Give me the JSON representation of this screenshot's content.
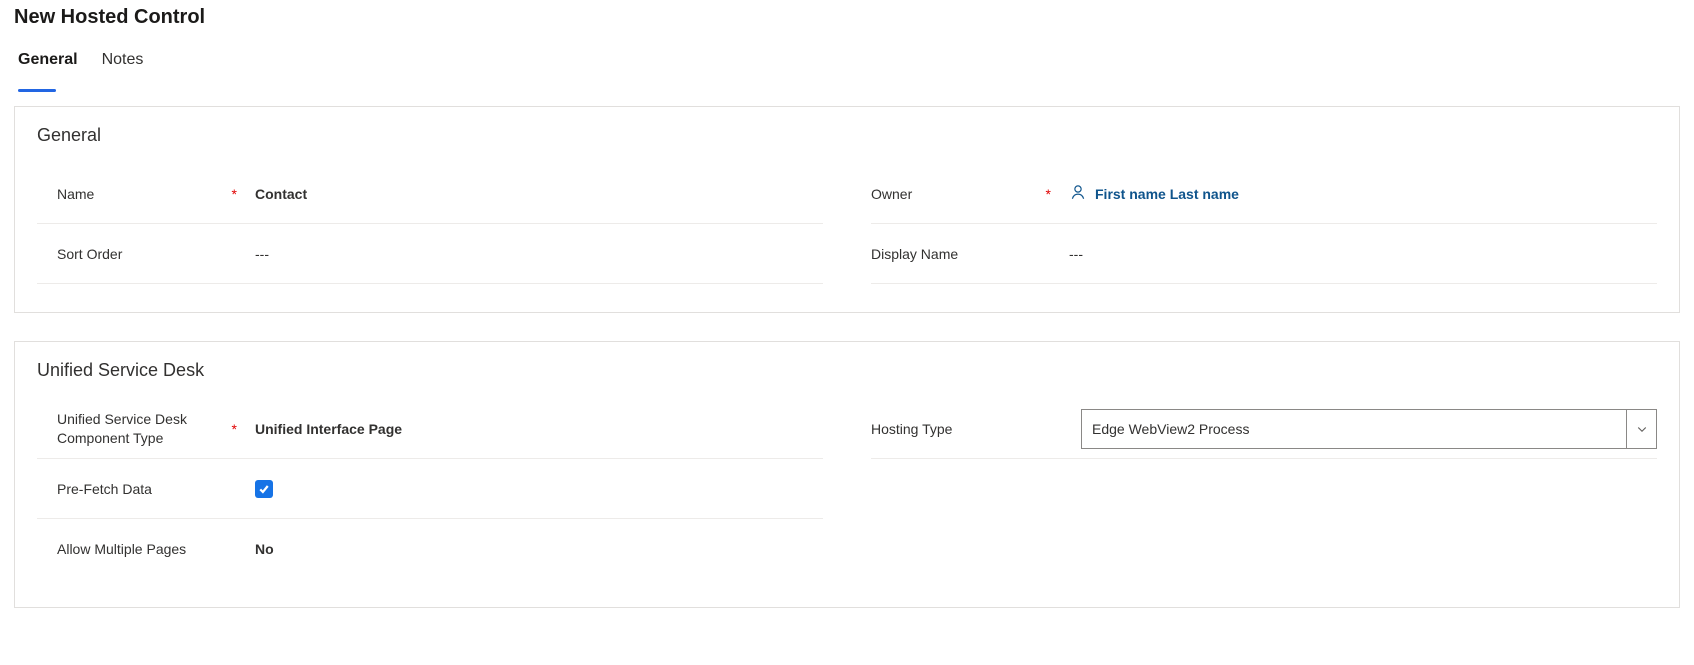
{
  "page_title": "New Hosted Control",
  "tabs": {
    "general": "General",
    "notes": "Notes"
  },
  "sections": {
    "general": {
      "title": "General",
      "fields": {
        "name": {
          "label": "Name",
          "value": "Contact",
          "required": true
        },
        "sort_order": {
          "label": "Sort Order",
          "value": "---"
        },
        "owner": {
          "label": "Owner",
          "value": "First name Last name",
          "required": true
        },
        "display_name": {
          "label": "Display Name",
          "value": "---"
        }
      }
    },
    "usd": {
      "title": "Unified Service Desk",
      "fields": {
        "component_type": {
          "label": "Unified Service Desk Component Type",
          "value": "Unified Interface Page",
          "required": true
        },
        "prefetch": {
          "label": "Pre-Fetch Data",
          "checked": true
        },
        "allow_multiple": {
          "label": "Allow Multiple Pages",
          "value": "No"
        },
        "hosting_type": {
          "label": "Hosting Type",
          "value": "Edge WebView2 Process"
        }
      }
    }
  }
}
